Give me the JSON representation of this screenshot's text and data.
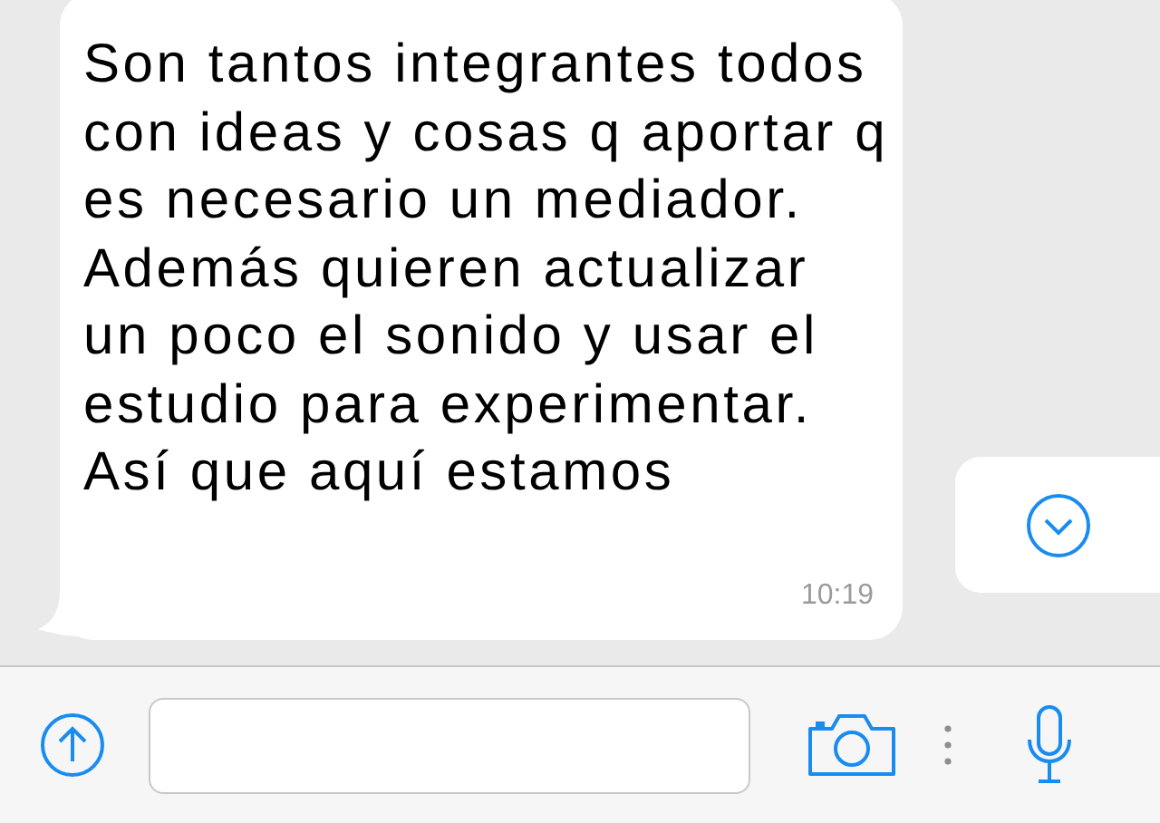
{
  "message": {
    "text": "Son tantos integrantes todos con ideas y cosas q aportar q es necesario un mediador. Además quieren actualizar un poco el sonido y usar el estudio para experimentar. Así que aquí estamos",
    "time": "10:19"
  }
}
